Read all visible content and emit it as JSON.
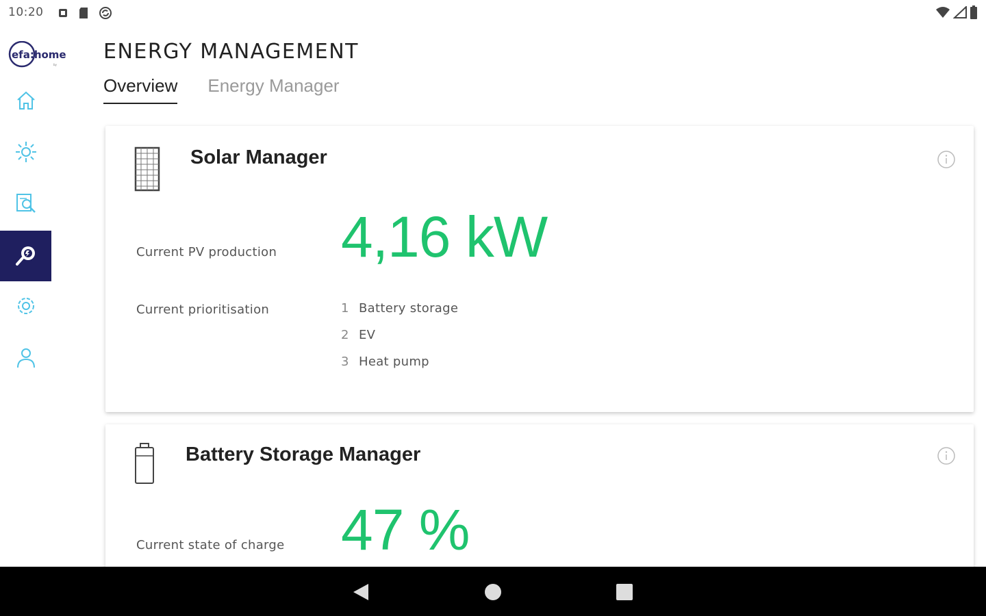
{
  "status_bar": {
    "time": "10:20"
  },
  "header": {
    "title": "ENERGY MANAGEMENT"
  },
  "tabs": [
    {
      "label": "Overview",
      "active": true
    },
    {
      "label": "Energy Manager",
      "active": false
    }
  ],
  "sidebar": {
    "logo_text": "efa:home",
    "items": [
      {
        "icon": "home-icon",
        "active": false
      },
      {
        "icon": "sun-icon",
        "active": false
      },
      {
        "icon": "search-report-icon",
        "active": false
      },
      {
        "icon": "energy-search-icon",
        "active": true
      },
      {
        "icon": "gear-icon",
        "active": false
      },
      {
        "icon": "user-icon",
        "active": false
      }
    ]
  },
  "solar_card": {
    "title": "Solar Manager",
    "pv_label": "Current PV production",
    "pv_value": "4,16 kW",
    "prio_label": "Current prioritisation",
    "priorities": [
      {
        "num": "1",
        "label": "Battery storage"
      },
      {
        "num": "2",
        "label": "EV"
      },
      {
        "num": "3",
        "label": "Heat pump"
      }
    ]
  },
  "battery_card": {
    "title": "Battery Storage Manager",
    "soc_label": "Current state of charge",
    "soc_value": "47 %"
  },
  "colors": {
    "accent_green": "#1fc36e",
    "sidebar_active": "#1f1f5f",
    "icon_cyan": "#4fc3e6"
  }
}
